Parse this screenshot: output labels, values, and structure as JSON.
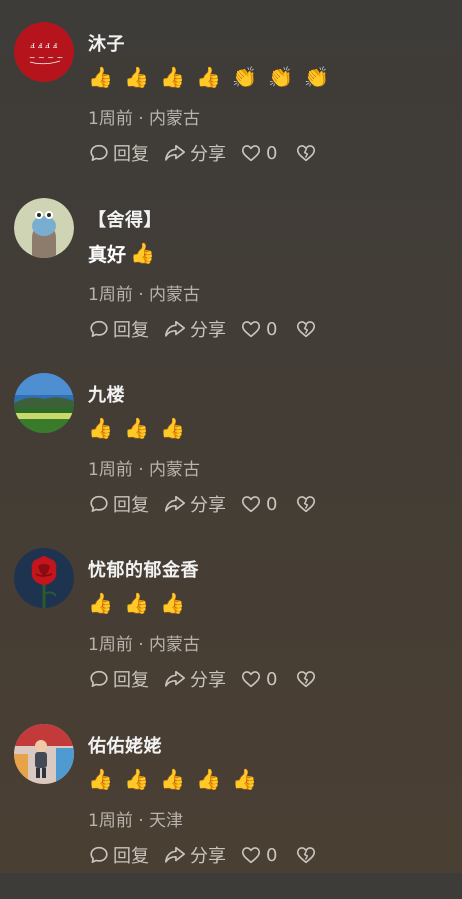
{
  "labels": {
    "reply": "回复",
    "share": "分享"
  },
  "colors": {
    "background_top": "#3e3c39",
    "background_bottom": "#4a3f33",
    "username": "#f2f2f2",
    "meta": "#b8b4ad",
    "action": "#c9c5be"
  },
  "comments": [
    {
      "username": "沐子",
      "text": "",
      "emojis": "👍👍👍👍👏👏👏",
      "time": "1周前",
      "location": "内蒙古",
      "likes": "0",
      "avatar_icon": "calligraphy-avatar"
    },
    {
      "username": "【舍得】",
      "text": "真好",
      "emojis": "👍",
      "time": "1周前",
      "location": "内蒙古",
      "likes": "0",
      "avatar_icon": "cartoon-avatar"
    },
    {
      "username": "九楼",
      "text": "",
      "emojis": "👍👍👍",
      "time": "1周前",
      "location": "内蒙古",
      "likes": "0",
      "avatar_icon": "landscape-avatar"
    },
    {
      "username": "忧郁的郁金香",
      "text": "",
      "emojis": "👍👍👍",
      "time": "1周前",
      "location": "内蒙古",
      "likes": "0",
      "avatar_icon": "red-rose-avatar"
    },
    {
      "username": "佑佑姥姥",
      "text": "",
      "emojis": "👍👍👍👍👍",
      "time": "1周前",
      "location": "天津",
      "likes": "0",
      "avatar_icon": "child-photo-avatar"
    }
  ]
}
